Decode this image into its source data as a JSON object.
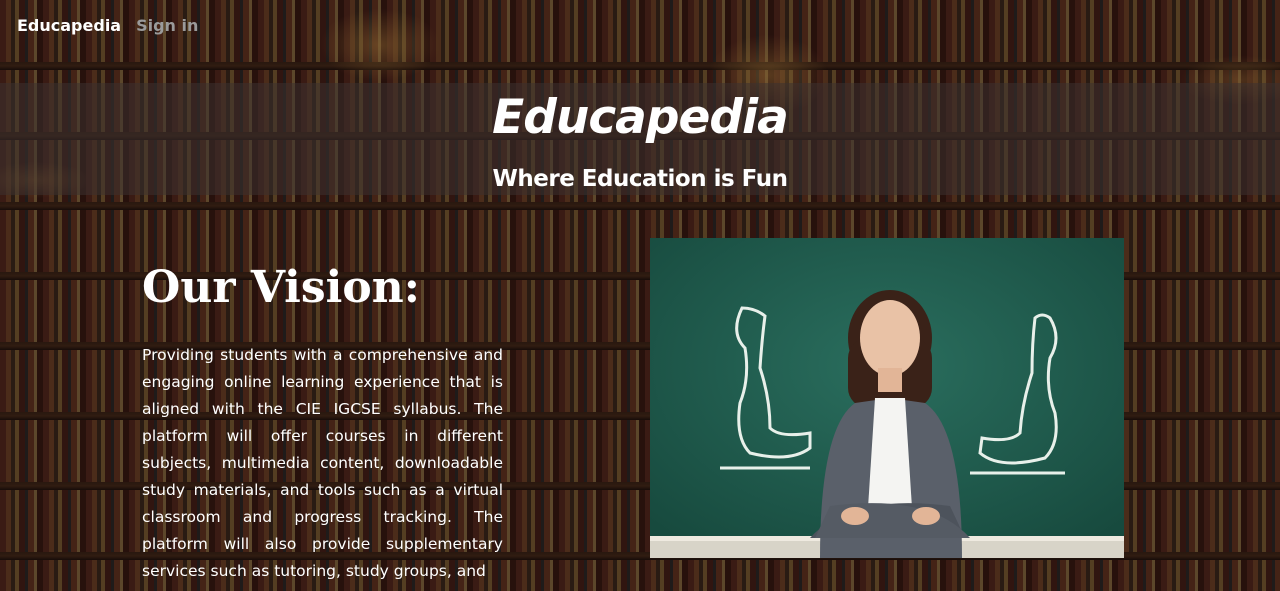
{
  "nav": {
    "brand": "Educapedia",
    "signin": "Sign in"
  },
  "hero": {
    "title": "Educapedia",
    "subtitle": "Where Education is Fun"
  },
  "vision": {
    "heading": "Our Vision:",
    "body": "Providing students with a comprehensive and engaging online learning experience that is aligned with the CIE IGCSE syllabus. The platform will offer courses in different subjects, multimedia content, downloadable study materials, and tools such as a virtual classroom and progress tracking. The platform will also provide supplementary services such as tutoring, study groups, and"
  },
  "colors": {
    "nav_brand": "#ffffff",
    "nav_signin": "#9a9a9a",
    "chalkboard": "#1f5a4c"
  }
}
